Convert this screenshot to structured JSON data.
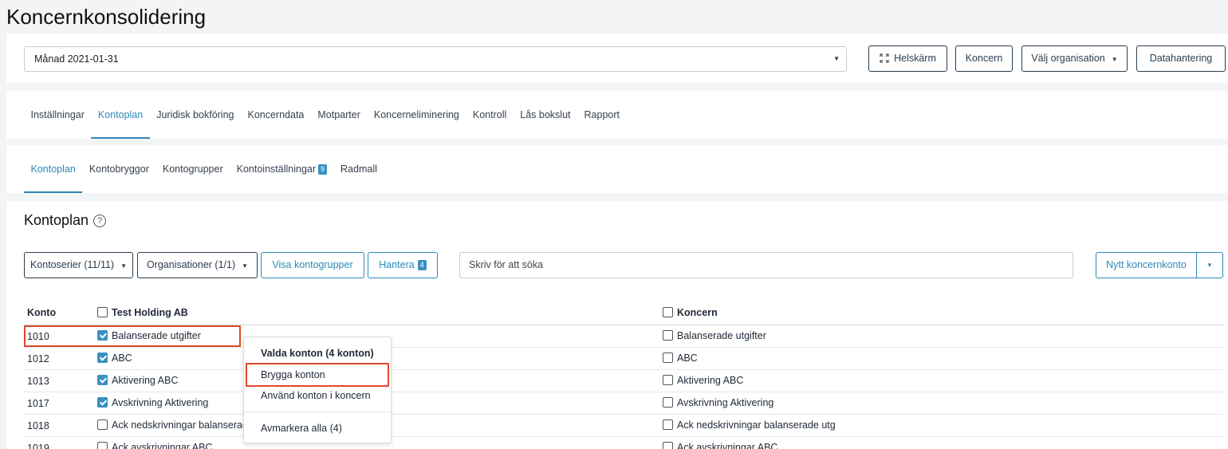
{
  "page": {
    "title": "Koncernkonsolidering"
  },
  "toolbar": {
    "period": "Månad 2021-01-31",
    "fullscreen": "Helskärm",
    "koncern": "Koncern",
    "select_org": "Välj organisation",
    "data": "Datahantering"
  },
  "nav_main": [
    "Inställningar",
    "Kontoplan",
    "Juridisk bokföring",
    "Koncerndata",
    "Motparter",
    "Koncerneliminering",
    "Kontroll",
    "Lås bokslut",
    "Rapport"
  ],
  "nav_sub": {
    "t0": "Kontoplan",
    "t1": "Kontobryggor",
    "t2": "Kontogrupper",
    "t3": "Kontoinställningar",
    "t3_badge": "9",
    "t4": "Radmall"
  },
  "section": {
    "title": "Kontoplan",
    "help": "?"
  },
  "filters": {
    "series": "Kontoserier (11/11)",
    "orgs": "Organisationer (1/1)",
    "visa": "Visa kontogrupper",
    "hantera": "Hantera",
    "hantera_badge": "4",
    "search_placeholder": "Skriv för att söka",
    "new_account": "Nytt koncernkonto"
  },
  "table": {
    "col_konto": "Konto",
    "col_holding": "Test Holding AB",
    "col_koncern": "Koncern",
    "rows": [
      {
        "konto": "1010",
        "account": "Balanserade utgifter",
        "checked": true,
        "koncern": "Balanserade utgifter"
      },
      {
        "konto": "1012",
        "account": "ABC",
        "checked": true,
        "koncern": "ABC"
      },
      {
        "konto": "1013",
        "account": "Aktivering ABC",
        "checked": true,
        "koncern": "Aktivering ABC"
      },
      {
        "konto": "1017",
        "account": "Avskrivning Aktivering",
        "checked": true,
        "koncern": "Avskrivning Aktivering"
      },
      {
        "konto": "1018",
        "account": "Ack nedskrivningar balanserade utg",
        "checked": false,
        "koncern": "Ack nedskrivningar balanserade utg"
      },
      {
        "konto": "1019",
        "account": "Ack avskrivningar ABC",
        "checked": false,
        "koncern": "Ack avskrivningar ABC"
      }
    ]
  },
  "context_menu": {
    "header": "Valda konton (4 konton)",
    "bridge": "Brygga konton",
    "use": "Använd konton i koncern",
    "unselect": "Avmarkera alla (4)"
  },
  "colors": {
    "accent": "#2d8ab8",
    "highlight": "#e0492b",
    "dark": "#2c3e50"
  }
}
